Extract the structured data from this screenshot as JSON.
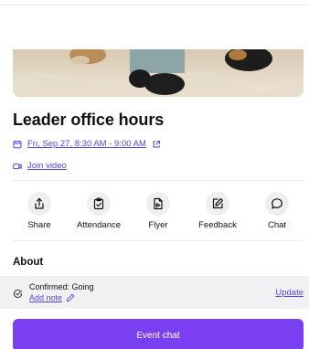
{
  "event": {
    "title": "Leader office hours",
    "datetime": "Fri, Sep 27, 8:30 AM - 9:00 AM",
    "video_link": "Join video"
  },
  "actions": [
    {
      "label": "Share",
      "icon": "share-icon"
    },
    {
      "label": "Attendance",
      "icon": "clipboard-check-icon"
    },
    {
      "label": "Flyer",
      "icon": "flyer-icon"
    },
    {
      "label": "Feedback",
      "icon": "pencil-square-icon"
    },
    {
      "label": "Chat",
      "icon": "chat-bubble-icon"
    }
  ],
  "about": {
    "heading": "About",
    "status": "Confirmed: Going",
    "add_note": "Add note",
    "update": "Update"
  },
  "footer": {
    "event_chat": "Event chat"
  },
  "colors": {
    "accent": "#5a3fd8",
    "button": "#7b3ff2"
  }
}
